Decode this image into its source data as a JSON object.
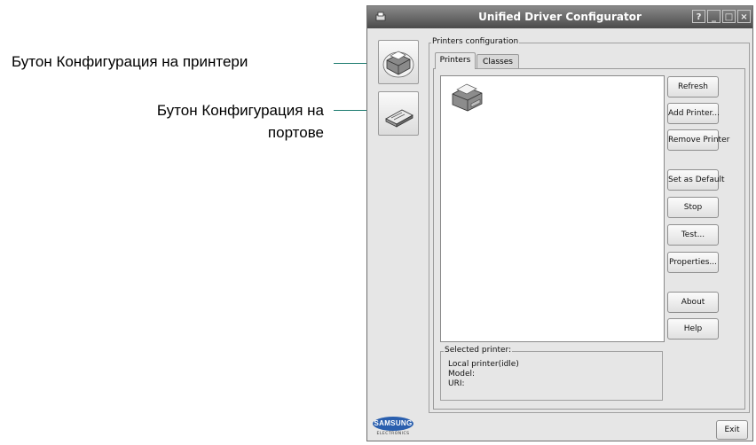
{
  "callouts": {
    "printers_button_label": "Бутон Конфигурация на принтери",
    "ports_button_label_line1": "Бутон Конфигурация на",
    "ports_button_label_line2": "портове"
  },
  "window": {
    "title": "Unified Driver Configurator",
    "controls": [
      "?",
      "_",
      "□",
      "×"
    ]
  },
  "sidebar": {
    "items": [
      {
        "name": "printers-configuration",
        "icon": "printer-icon"
      },
      {
        "name": "ports-configuration",
        "icon": "port-icon"
      }
    ]
  },
  "main": {
    "group_title": "Printers configuration",
    "tabs": [
      {
        "label": "Printers",
        "active": true
      },
      {
        "label": "Classes",
        "active": false
      }
    ],
    "printer_list": [
      {
        "icon": "printer-icon",
        "label": ""
      }
    ],
    "buttons": {
      "refresh": "Refresh",
      "add_printer": "Add Printer...",
      "remove_printer": "Remove Printer",
      "set_default": "Set as Default",
      "stop": "Stop",
      "test": "Test...",
      "properties": "Properties...",
      "about": "About",
      "help": "Help"
    },
    "selected_printer": {
      "title": "Selected printer:",
      "status": "Local printer(idle)",
      "model": "Model:",
      "uri": "URI:"
    }
  },
  "footer": {
    "brand": "SAMSUNG",
    "brand_sub": "ELECTRONICS",
    "exit_label": "Exit"
  },
  "colors": {
    "callout_line": "#1a7a6e",
    "titlebar": "#5a5a5a",
    "window_bg": "#e6e6e6",
    "brand_blue": "#2a5fae"
  }
}
